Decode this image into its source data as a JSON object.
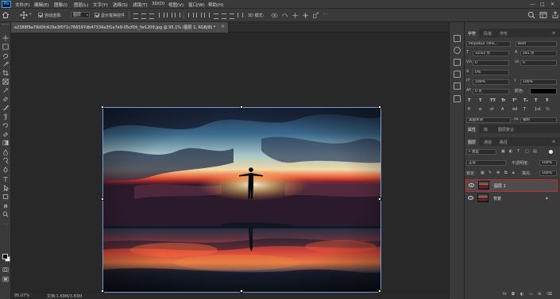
{
  "app": {
    "logo": "Ps"
  },
  "menu": [
    "文件(F)",
    "编辑(E)",
    "图像(I)",
    "图层(L)",
    "文字(Y)",
    "选择(S)",
    "滤镜(T)",
    "3D(D)",
    "视图(V)",
    "窗口(W)",
    "帮助(H)"
  ],
  "window_controls": {
    "minimize": "—",
    "maximize": "□",
    "close": "✕"
  },
  "options_bar": {
    "auto_select_label": "自动选择:",
    "auto_select_value": "图层",
    "show_transform_label": "显示变换控件",
    "mode_3d_label": "3D 模式:"
  },
  "document": {
    "tab_title": "a2388f9a79d0fc629e3f071c766597db47334a3f1a7e9-05cfOh_fw1200.jpg @ 95.1% (图层 1, RGB/8) *",
    "close": "×"
  },
  "status": {
    "zoom": "95.07%",
    "doc_info": "文档:1.69M/3.63M"
  },
  "char_panel": {
    "tabs": [
      "字符",
      "段落",
      "字形"
    ],
    "font_family": "Perpetua Titlin...",
    "font_style": "Bold",
    "font_size": "33.83 点",
    "leading": "281 点",
    "kerning": "0",
    "tracking": "0",
    "vscale_pct": "0%",
    "scale_h": "100%",
    "scale_v": "100%",
    "baseline": "0 点",
    "color_label": "颜色:",
    "style_buttons": [
      "T",
      "T",
      "TT",
      "Tr",
      "T¹",
      "T₁",
      "T",
      "Ŧ"
    ],
    "opentype_buttons": [
      "fi",
      "ơ",
      "st",
      "A",
      "ād",
      "T",
      "1st",
      "½"
    ],
    "language": "美国英语",
    "antialias": "锐利",
    "aa_label": "aa"
  },
  "props_tabs": [
    "属性",
    "库",
    "图层复合"
  ],
  "layers_panel": {
    "tabs": [
      "图层",
      "通道",
      "路径"
    ],
    "filter_label": "类型",
    "blend_mode": "正常",
    "opacity_label": "不透明度:",
    "opacity_value": "100%",
    "lock_label": "锁定:",
    "fill_label": "填充:",
    "fill_value": "100%",
    "layers": [
      {
        "name": "图层 1",
        "selected": true
      },
      {
        "name": "背景",
        "selected": false,
        "locked": true
      }
    ]
  },
  "layers_footer": [
    "fx",
    "◘",
    "◐",
    "▭",
    "⊕",
    "⌫"
  ],
  "colors": {
    "selection_highlight": "#c8262c",
    "accent": "#31a8ff"
  }
}
